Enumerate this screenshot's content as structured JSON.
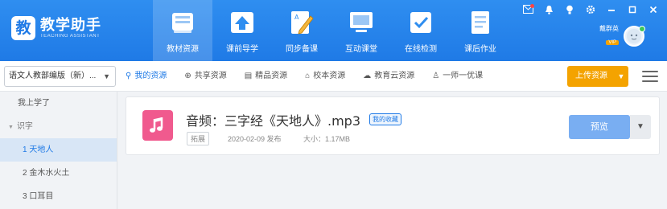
{
  "app": {
    "title": "教学助手",
    "subtitle": "TEACHING ASSISTANT",
    "logo_char": "教"
  },
  "nav": [
    {
      "label": "教材资源",
      "icon": "textbook-icon",
      "active": true
    },
    {
      "label": "课前导学",
      "icon": "upload-arrow-icon",
      "active": false
    },
    {
      "label": "同步备课",
      "icon": "pencil-icon",
      "active": false
    },
    {
      "label": "互动课堂",
      "icon": "classroom-screen-icon",
      "active": false
    },
    {
      "label": "在线检测",
      "icon": "checklist-icon",
      "active": false
    },
    {
      "label": "课后作业",
      "icon": "homework-icon",
      "active": false
    }
  ],
  "window": {
    "icons": [
      "message-icon",
      "notification-bell-icon",
      "tips-icon",
      "settings-gear-icon",
      "minimize-icon",
      "maximize-icon",
      "close-icon"
    ]
  },
  "user": {
    "name": "戴群英",
    "badge": "VIP"
  },
  "edition": {
    "selected": "语文人教部编版（新）..."
  },
  "resource_tabs": [
    {
      "label": "我的资源",
      "icon": "user-resource-icon",
      "active": true
    },
    {
      "label": "共享资源",
      "icon": "globe-icon",
      "active": false
    },
    {
      "label": "精品资源",
      "icon": "document-icon",
      "active": false
    },
    {
      "label": "校本资源",
      "icon": "school-icon",
      "active": false
    },
    {
      "label": "教育云资源",
      "icon": "cloud-icon",
      "active": false
    },
    {
      "label": "一师一优课",
      "icon": "teacher-icon",
      "active": false
    }
  ],
  "upload_button": "上传资源",
  "sidebar": {
    "items": [
      {
        "label": "我上学了",
        "kind": "top"
      },
      {
        "label": "识字",
        "kind": "group"
      },
      {
        "label": "1 天地人",
        "kind": "lesson",
        "active": true
      },
      {
        "label": "2 金木水火土",
        "kind": "lesson"
      },
      {
        "label": "3 口耳目",
        "kind": "lesson"
      }
    ]
  },
  "resource": {
    "title": "音频：三字经《天地人》.mp3",
    "favorite_label": "我的收藏",
    "tag": "拓展",
    "date": "2020-02-09 发布",
    "size": "大小：1.17MB",
    "preview_label": "预览"
  },
  "colors": {
    "primary": "#1f7ae6",
    "upload": "#f4a300",
    "audio_icon": "#f05a8e",
    "preview": "#79aef2"
  }
}
